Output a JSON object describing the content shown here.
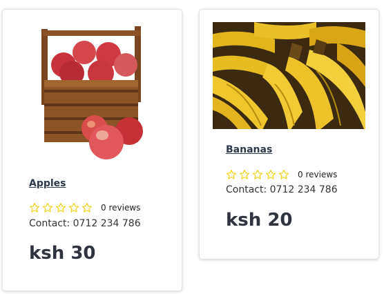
{
  "products": [
    {
      "name": "Apples",
      "rating": 0,
      "reviews": "0 reviews",
      "contact": "Contact: 0712 234 786",
      "price": "ksh 30",
      "image_icon": "apple-basket-image"
    },
    {
      "name": "Bananas",
      "rating": 0,
      "reviews": "0 reviews",
      "contact": "Contact: 0712 234 786",
      "price": "ksh 20",
      "image_icon": "banana-bunch-image"
    }
  ],
  "colors": {
    "star": "#f2d21b",
    "title": "#2e3a4b",
    "text": "#333333"
  }
}
